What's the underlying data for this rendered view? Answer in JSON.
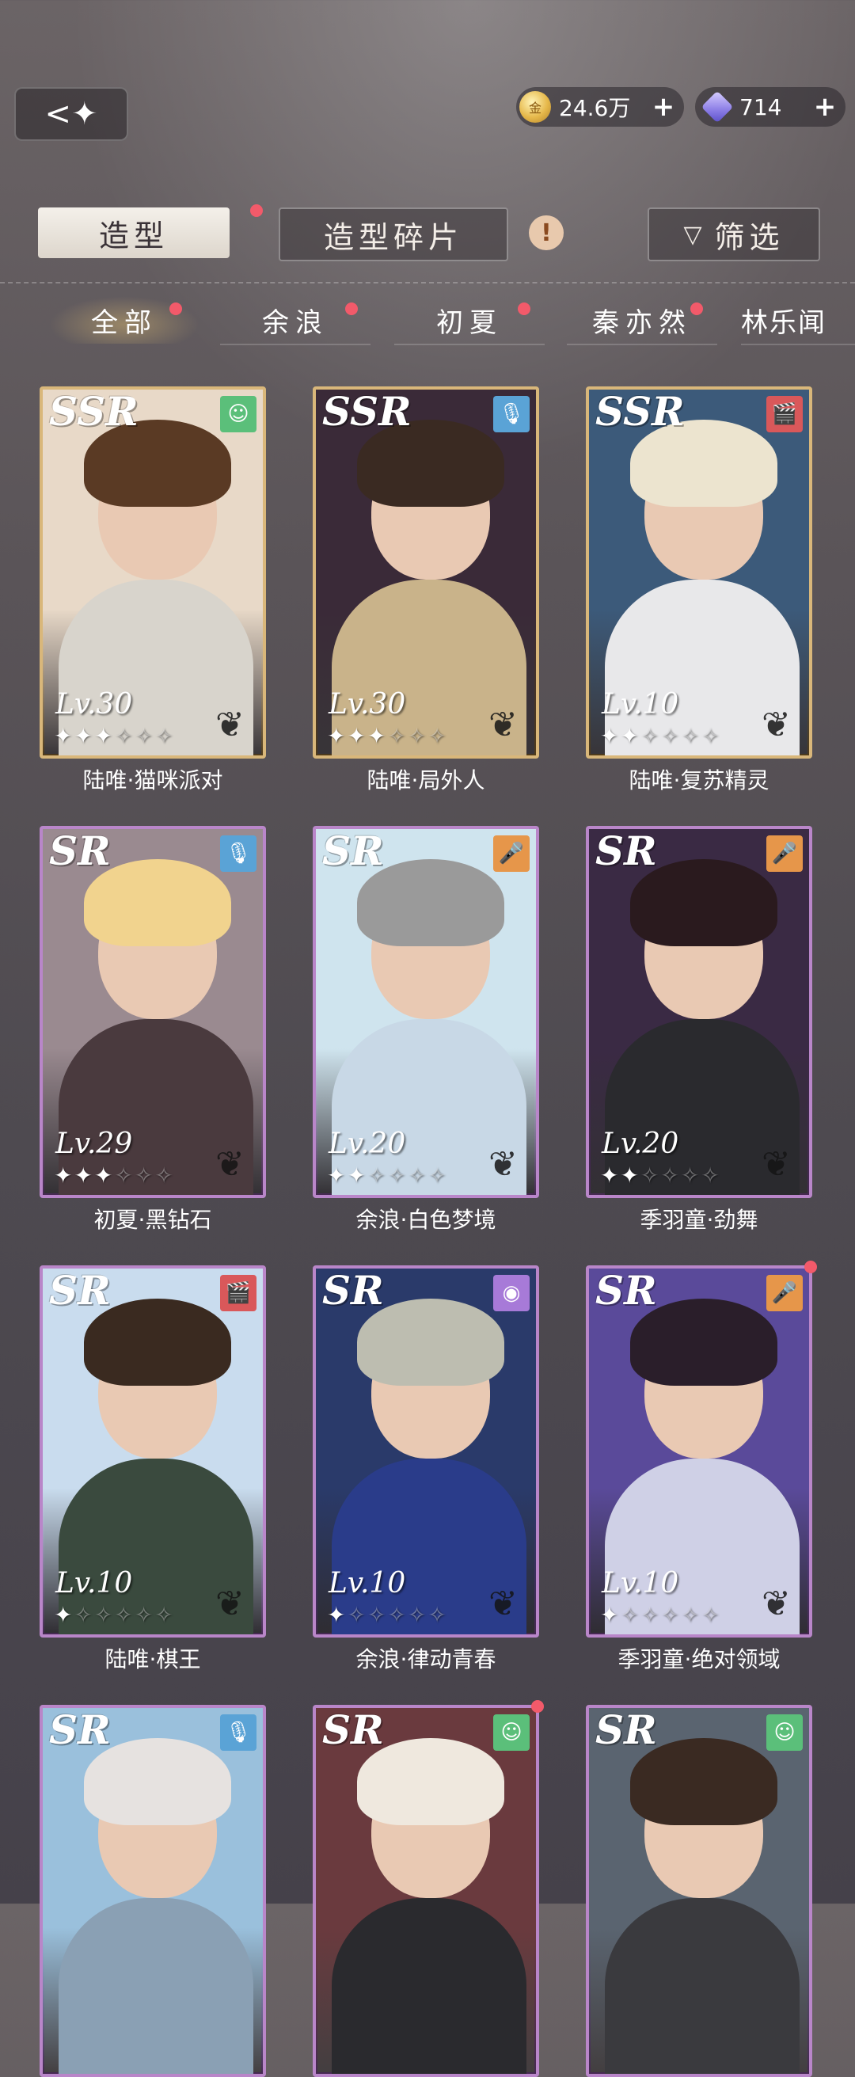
{
  "header": {
    "back_label": "<✦",
    "gold_value": "24.6万",
    "gem_value": "714",
    "plus": "+"
  },
  "tabs": {
    "outfit": "造型",
    "shards": "造型碎片",
    "filter": "筛选"
  },
  "char_tabs": [
    "全部",
    "余浪",
    "初夏",
    "秦亦然",
    "林乐闻"
  ],
  "cards": [
    {
      "rarity": "SSR",
      "level": "Lv.30",
      "name": "陆唯·猫咪派对",
      "icon": "smile-icon",
      "stars": 3
    },
    {
      "rarity": "SSR",
      "level": "Lv.30",
      "name": "陆唯·局外人",
      "icon": "mic-icon",
      "stars": 3
    },
    {
      "rarity": "SSR",
      "level": "Lv.10",
      "name": "陆唯·复苏精灵",
      "icon": "clapper-icon",
      "stars": 2
    },
    {
      "rarity": "SR",
      "level": "Lv.29",
      "name": "初夏·黑钻石",
      "icon": "mic-icon",
      "stars": 3
    },
    {
      "rarity": "SR",
      "level": "Lv.20",
      "name": "余浪·白色梦境",
      "icon": "handmic-icon",
      "stars": 2
    },
    {
      "rarity": "SR",
      "level": "Lv.20",
      "name": "季羽童·劲舞",
      "icon": "handmic-icon",
      "stars": 2
    },
    {
      "rarity": "SR",
      "level": "Lv.10",
      "name": "陆唯·棋王",
      "icon": "clapper-icon",
      "stars": 1
    },
    {
      "rarity": "SR",
      "level": "Lv.10",
      "name": "余浪·律动青春",
      "icon": "camera-icon",
      "stars": 1
    },
    {
      "rarity": "SR",
      "level": "Lv.10",
      "name": "季羽童·绝对领域",
      "icon": "handmic-icon",
      "stars": 1
    },
    {
      "rarity": "SR",
      "level": "",
      "name": "",
      "icon": "mic-icon",
      "stars": 0
    },
    {
      "rarity": "SR",
      "level": "",
      "name": "",
      "icon": "smile-icon",
      "stars": 0
    },
    {
      "rarity": "SR",
      "level": "",
      "name": "",
      "icon": "smile-icon",
      "stars": 0
    }
  ],
  "colors": {
    "ssr_border": "#d9b77a",
    "sr_border": "#b986c9",
    "notification": "#f25a6a"
  }
}
